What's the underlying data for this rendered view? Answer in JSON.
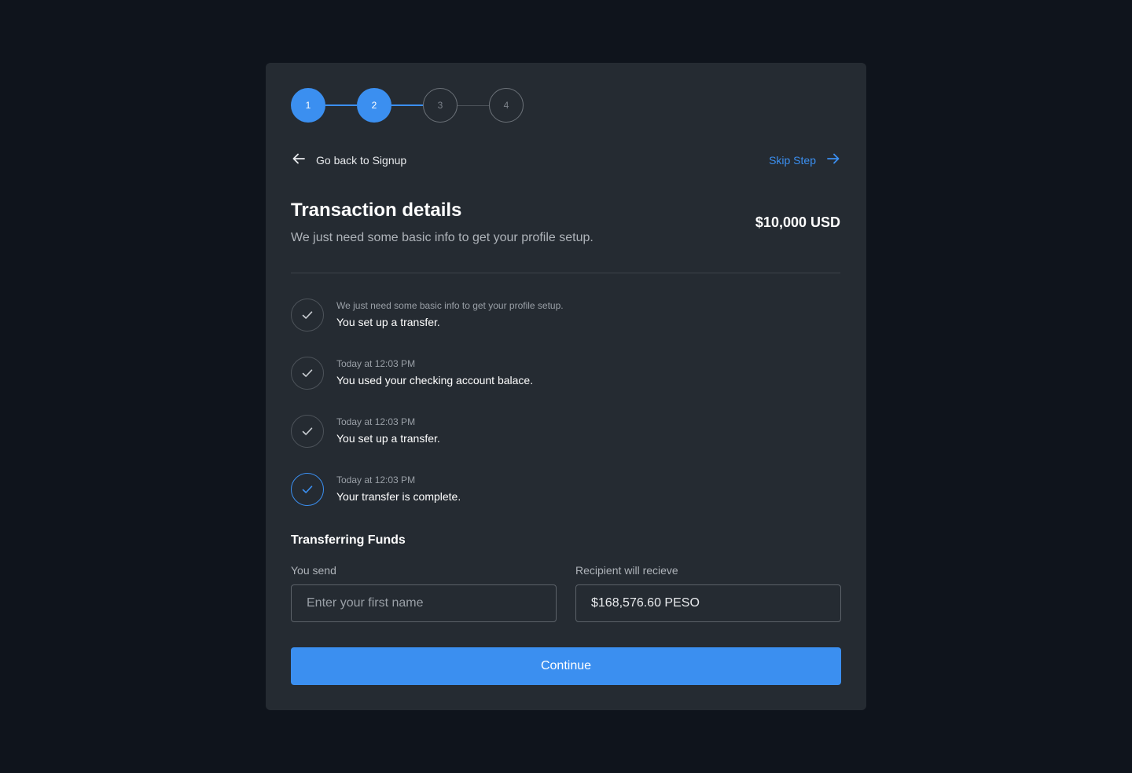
{
  "stepper": {
    "steps": [
      {
        "label": "1",
        "state": "active"
      },
      {
        "label": "2",
        "state": "active"
      },
      {
        "label": "3",
        "state": "inactive"
      },
      {
        "label": "4",
        "state": "inactive"
      }
    ]
  },
  "nav": {
    "back_label": "Go back to Signup",
    "skip_label": "Skip Step"
  },
  "header": {
    "title": "Transaction details",
    "subtitle": "We just need some basic info to get your profile setup.",
    "amount": "$10,000 USD"
  },
  "timeline": [
    {
      "meta": "We just need some basic info to get your profile setup.",
      "text": "You set up a transfer.",
      "done": false
    },
    {
      "meta": "Today at 12:03 PM",
      "text": "You used your checking account balace.",
      "done": false
    },
    {
      "meta": "Today at 12:03 PM",
      "text": "You set up a transfer.",
      "done": false
    },
    {
      "meta": "Today at 12:03 PM",
      "text": "Your transfer is complete.",
      "done": true
    }
  ],
  "transfer": {
    "section_title": "Transferring Funds",
    "send_label": "You send",
    "send_placeholder": "Enter your first name",
    "receive_label": "Recipient will recieve",
    "receive_value": "$168,576.60 PESO"
  },
  "actions": {
    "continue_label": "Continue"
  },
  "colors": {
    "accent": "#3b8ff0",
    "background": "#0f141c",
    "card": "#252b32"
  }
}
